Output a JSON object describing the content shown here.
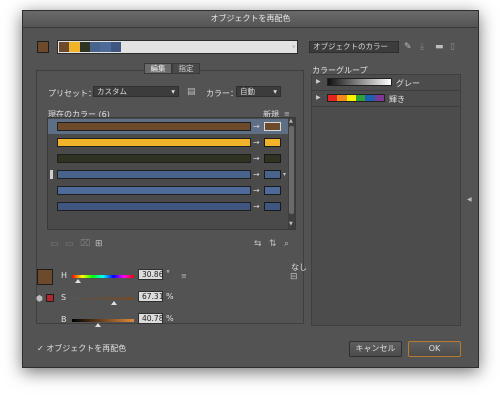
{
  "dialog": {
    "title": "オブジェクトを再配色"
  },
  "top": {
    "preset_name": "オブジェクトのカラー",
    "colors": {
      "swatch": "#6e4a2c"
    },
    "strip_colors": [
      "#6e4a2c",
      "#f0b32a",
      "#2f3321",
      "#48638c",
      "#4e6a98",
      "#3e5680"
    ]
  },
  "tabs": {
    "edit": "編集",
    "assign": "指定"
  },
  "options": {
    "preset_label": "プリセット：",
    "preset_value": "カスタム",
    "colors_label": "カラー：",
    "colors_value": "自動"
  },
  "list": {
    "current_header": "現在のカラー (6)",
    "new_header": "新規",
    "rows": [
      {
        "current": "#6e4a2c",
        "new": "#6e4a2c"
      },
      {
        "current": "#f0b32a",
        "new": "#f0b32a"
      },
      {
        "current": "#2f3321",
        "new": "#2f3321"
      },
      {
        "current": "#48638c",
        "new": "#48638c"
      },
      {
        "current": "#4e6a98",
        "new": "#4e6a98"
      },
      {
        "current": "#3e5680",
        "new": "#3e5680"
      }
    ]
  },
  "hsb": {
    "h_label": "H",
    "h_value": "30.86",
    "h_unit": "°",
    "s_label": "S",
    "s_value": "67.31",
    "s_unit": "%",
    "b_label": "B",
    "b_value": "40.78",
    "b_unit": "%",
    "none_label": "なし"
  },
  "color_groups": {
    "header": "カラーグループ",
    "groups": [
      {
        "name": "グレー"
      },
      {
        "name": "輝き",
        "colors": [
          "#e52421",
          "#f28a1e",
          "#fff100",
          "#2ca137",
          "#1f5fb0",
          "#7b3a96"
        ]
      }
    ]
  },
  "footer": {
    "recolor_checkbox": "オブジェクトを再配色",
    "cancel": "キャンセル",
    "ok": "OK"
  }
}
